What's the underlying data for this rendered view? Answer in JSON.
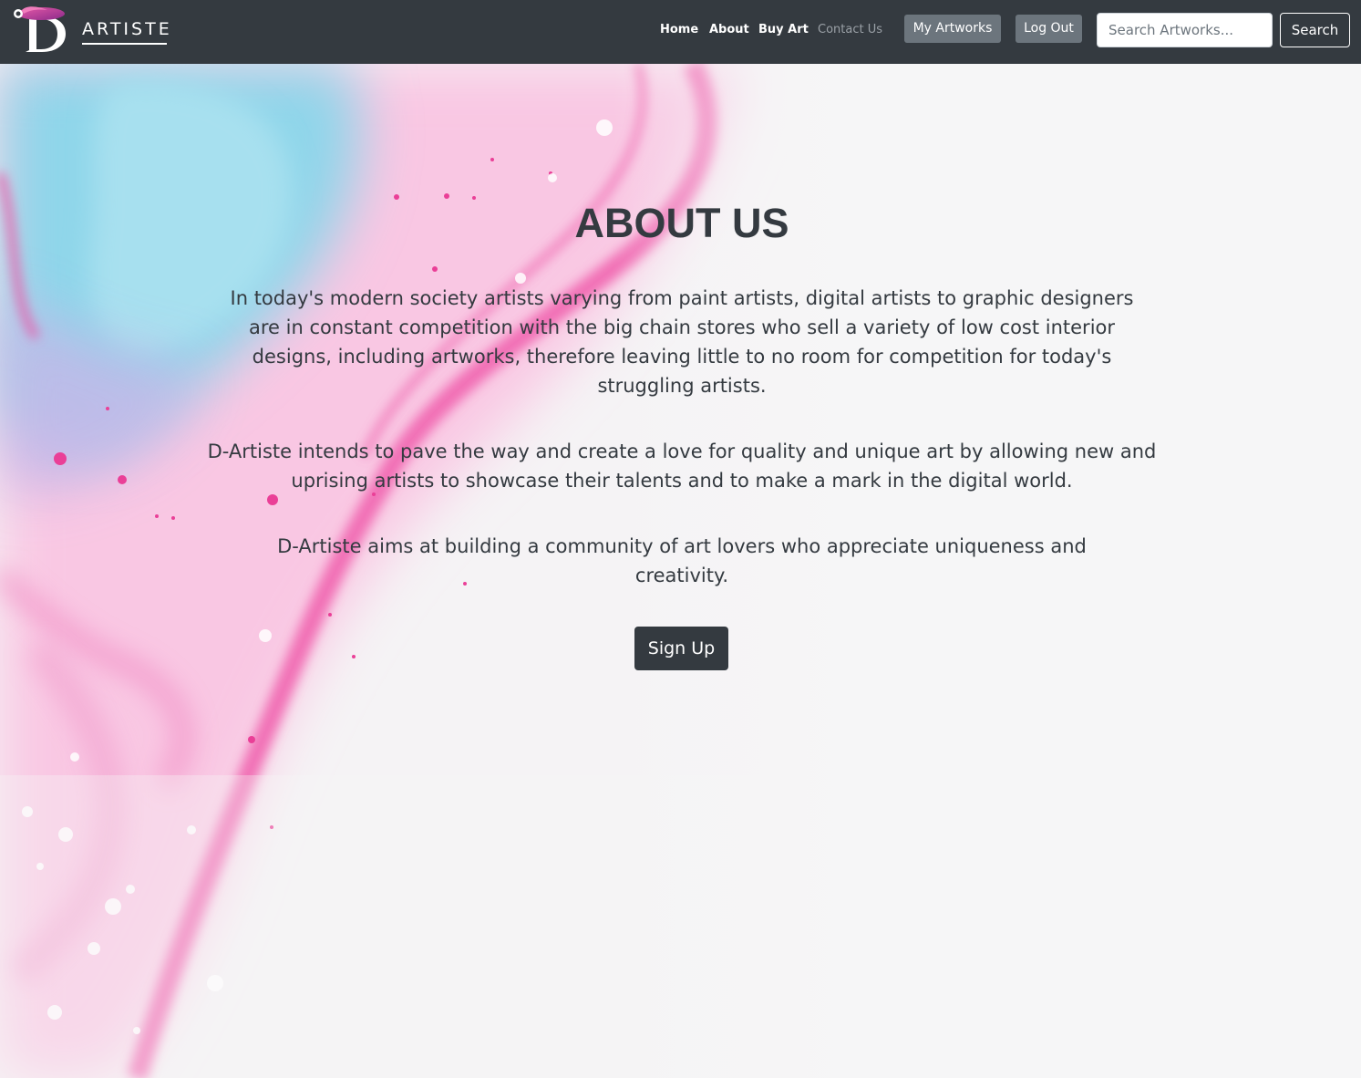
{
  "brand": {
    "name": "ARTISTE",
    "logo_icon": "d-letter-logo-icon"
  },
  "nav": {
    "links": [
      "Home",
      "About",
      "Buy Art",
      "Contact Us"
    ],
    "my_artworks": "My Artworks",
    "log_out": "Log Out",
    "search_placeholder": "Search Artworks...",
    "search_label": "Search"
  },
  "about": {
    "title": "ABOUT US",
    "paragraphs": [
      "In today's modern society artists varying from paint artists, digital artists to graphic designers are in constant competition with the big chain stores who sell a variety of low cost interior designs, including artworks, therefore leaving little to no room for competition for today's struggling artists.",
      "D-Artiste intends to pave the way and create a love for quality and unique art by allowing new and uprising artists to showcase their talents and to make a mark in the digital world.",
      "D-Artiste aims at building a community of art lovers who appreciate uniqueness and creativity."
    ],
    "signup_label": "Sign Up"
  },
  "colors": {
    "navbar": "#343a40",
    "nav_button": "#6c757d",
    "text_dark": "#343a40",
    "accent_pink": "#f0479a",
    "accent_blue": "#7ed3e6"
  }
}
